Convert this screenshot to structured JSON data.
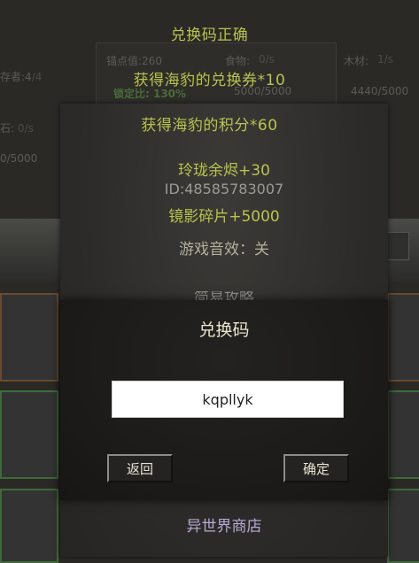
{
  "background": {
    "resources": {
      "anchor_label": "锚点值:260",
      "food_label": "食物:",
      "food_rate": "0/s",
      "wood_label": "木材:",
      "wood_rate": "1/s",
      "lock_ratio": "锁定比: 130%",
      "food_capacity": "5000/5000",
      "wood_capacity": "4440/5000"
    },
    "left_fragments": {
      "survivors": "存者:4",
      "survivors_tail": "/4",
      "stone": "石:",
      "stone_rate": "0/s",
      "stone_capacity": "0/5000"
    },
    "guide_partial": "简易攻略"
  },
  "toasts": {
    "redeem_ok": "兑换码正确",
    "coupon_reward": "获得海豹的兑换券*10",
    "points_reward": "获得海豹的积分*60"
  },
  "panel": {
    "ember_reward": "玲珑余烬+30",
    "player_id": "ID:48585783007",
    "mirror_reward": "镜影碎片+5000",
    "sound_setting": "游戏音效：关",
    "shop_label": "异世界商店"
  },
  "dialog": {
    "title": "兑换码",
    "input_value": "kqpllyk",
    "back_label": "返回",
    "confirm_label": "确定"
  },
  "colors": {
    "toast_green": "#b9c34e",
    "dialog_title": "#ece6cf",
    "shop_purple": "#b7a9d4"
  }
}
